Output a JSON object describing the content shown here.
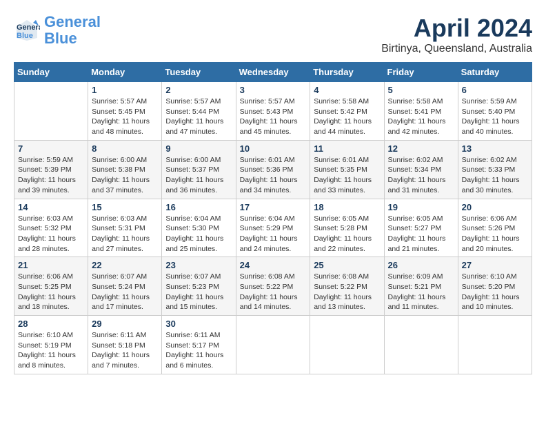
{
  "header": {
    "logo_line1": "General",
    "logo_line2": "Blue",
    "month": "April 2024",
    "location": "Birtinya, Queensland, Australia"
  },
  "weekdays": [
    "Sunday",
    "Monday",
    "Tuesday",
    "Wednesday",
    "Thursday",
    "Friday",
    "Saturday"
  ],
  "weeks": [
    [
      {
        "day": "",
        "details": ""
      },
      {
        "day": "1",
        "details": "Sunrise: 5:57 AM\nSunset: 5:45 PM\nDaylight: 11 hours\nand 48 minutes."
      },
      {
        "day": "2",
        "details": "Sunrise: 5:57 AM\nSunset: 5:44 PM\nDaylight: 11 hours\nand 47 minutes."
      },
      {
        "day": "3",
        "details": "Sunrise: 5:57 AM\nSunset: 5:43 PM\nDaylight: 11 hours\nand 45 minutes."
      },
      {
        "day": "4",
        "details": "Sunrise: 5:58 AM\nSunset: 5:42 PM\nDaylight: 11 hours\nand 44 minutes."
      },
      {
        "day": "5",
        "details": "Sunrise: 5:58 AM\nSunset: 5:41 PM\nDaylight: 11 hours\nand 42 minutes."
      },
      {
        "day": "6",
        "details": "Sunrise: 5:59 AM\nSunset: 5:40 PM\nDaylight: 11 hours\nand 40 minutes."
      }
    ],
    [
      {
        "day": "7",
        "details": "Sunrise: 5:59 AM\nSunset: 5:39 PM\nDaylight: 11 hours\nand 39 minutes."
      },
      {
        "day": "8",
        "details": "Sunrise: 6:00 AM\nSunset: 5:38 PM\nDaylight: 11 hours\nand 37 minutes."
      },
      {
        "day": "9",
        "details": "Sunrise: 6:00 AM\nSunset: 5:37 PM\nDaylight: 11 hours\nand 36 minutes."
      },
      {
        "day": "10",
        "details": "Sunrise: 6:01 AM\nSunset: 5:36 PM\nDaylight: 11 hours\nand 34 minutes."
      },
      {
        "day": "11",
        "details": "Sunrise: 6:01 AM\nSunset: 5:35 PM\nDaylight: 11 hours\nand 33 minutes."
      },
      {
        "day": "12",
        "details": "Sunrise: 6:02 AM\nSunset: 5:34 PM\nDaylight: 11 hours\nand 31 minutes."
      },
      {
        "day": "13",
        "details": "Sunrise: 6:02 AM\nSunset: 5:33 PM\nDaylight: 11 hours\nand 30 minutes."
      }
    ],
    [
      {
        "day": "14",
        "details": "Sunrise: 6:03 AM\nSunset: 5:32 PM\nDaylight: 11 hours\nand 28 minutes."
      },
      {
        "day": "15",
        "details": "Sunrise: 6:03 AM\nSunset: 5:31 PM\nDaylight: 11 hours\nand 27 minutes."
      },
      {
        "day": "16",
        "details": "Sunrise: 6:04 AM\nSunset: 5:30 PM\nDaylight: 11 hours\nand 25 minutes."
      },
      {
        "day": "17",
        "details": "Sunrise: 6:04 AM\nSunset: 5:29 PM\nDaylight: 11 hours\nand 24 minutes."
      },
      {
        "day": "18",
        "details": "Sunrise: 6:05 AM\nSunset: 5:28 PM\nDaylight: 11 hours\nand 22 minutes."
      },
      {
        "day": "19",
        "details": "Sunrise: 6:05 AM\nSunset: 5:27 PM\nDaylight: 11 hours\nand 21 minutes."
      },
      {
        "day": "20",
        "details": "Sunrise: 6:06 AM\nSunset: 5:26 PM\nDaylight: 11 hours\nand 20 minutes."
      }
    ],
    [
      {
        "day": "21",
        "details": "Sunrise: 6:06 AM\nSunset: 5:25 PM\nDaylight: 11 hours\nand 18 minutes."
      },
      {
        "day": "22",
        "details": "Sunrise: 6:07 AM\nSunset: 5:24 PM\nDaylight: 11 hours\nand 17 minutes."
      },
      {
        "day": "23",
        "details": "Sunrise: 6:07 AM\nSunset: 5:23 PM\nDaylight: 11 hours\nand 15 minutes."
      },
      {
        "day": "24",
        "details": "Sunrise: 6:08 AM\nSunset: 5:22 PM\nDaylight: 11 hours\nand 14 minutes."
      },
      {
        "day": "25",
        "details": "Sunrise: 6:08 AM\nSunset: 5:22 PM\nDaylight: 11 hours\nand 13 minutes."
      },
      {
        "day": "26",
        "details": "Sunrise: 6:09 AM\nSunset: 5:21 PM\nDaylight: 11 hours\nand 11 minutes."
      },
      {
        "day": "27",
        "details": "Sunrise: 6:10 AM\nSunset: 5:20 PM\nDaylight: 11 hours\nand 10 minutes."
      }
    ],
    [
      {
        "day": "28",
        "details": "Sunrise: 6:10 AM\nSunset: 5:19 PM\nDaylight: 11 hours\nand 8 minutes."
      },
      {
        "day": "29",
        "details": "Sunrise: 6:11 AM\nSunset: 5:18 PM\nDaylight: 11 hours\nand 7 minutes."
      },
      {
        "day": "30",
        "details": "Sunrise: 6:11 AM\nSunset: 5:17 PM\nDaylight: 11 hours\nand 6 minutes."
      },
      {
        "day": "",
        "details": ""
      },
      {
        "day": "",
        "details": ""
      },
      {
        "day": "",
        "details": ""
      },
      {
        "day": "",
        "details": ""
      }
    ]
  ]
}
